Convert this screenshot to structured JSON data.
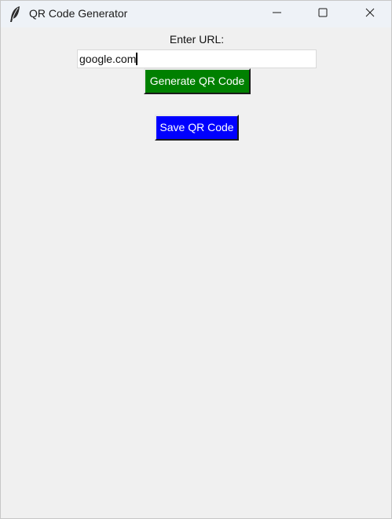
{
  "window": {
    "title": "QR Code Generator",
    "app_icon": "feather-icon",
    "controls": [
      "minimize-icon",
      "maximize-icon",
      "close-icon"
    ]
  },
  "form": {
    "url_label": "Enter URL:",
    "url_value": "google.com",
    "generate_label": "Generate QR Code",
    "save_label": "Save QR Code"
  },
  "colors": {
    "window_bg": "#f0f0f0",
    "generate_button_bg": "#008000",
    "save_button_bg": "#0000ff",
    "button_text": "#ffffff"
  }
}
